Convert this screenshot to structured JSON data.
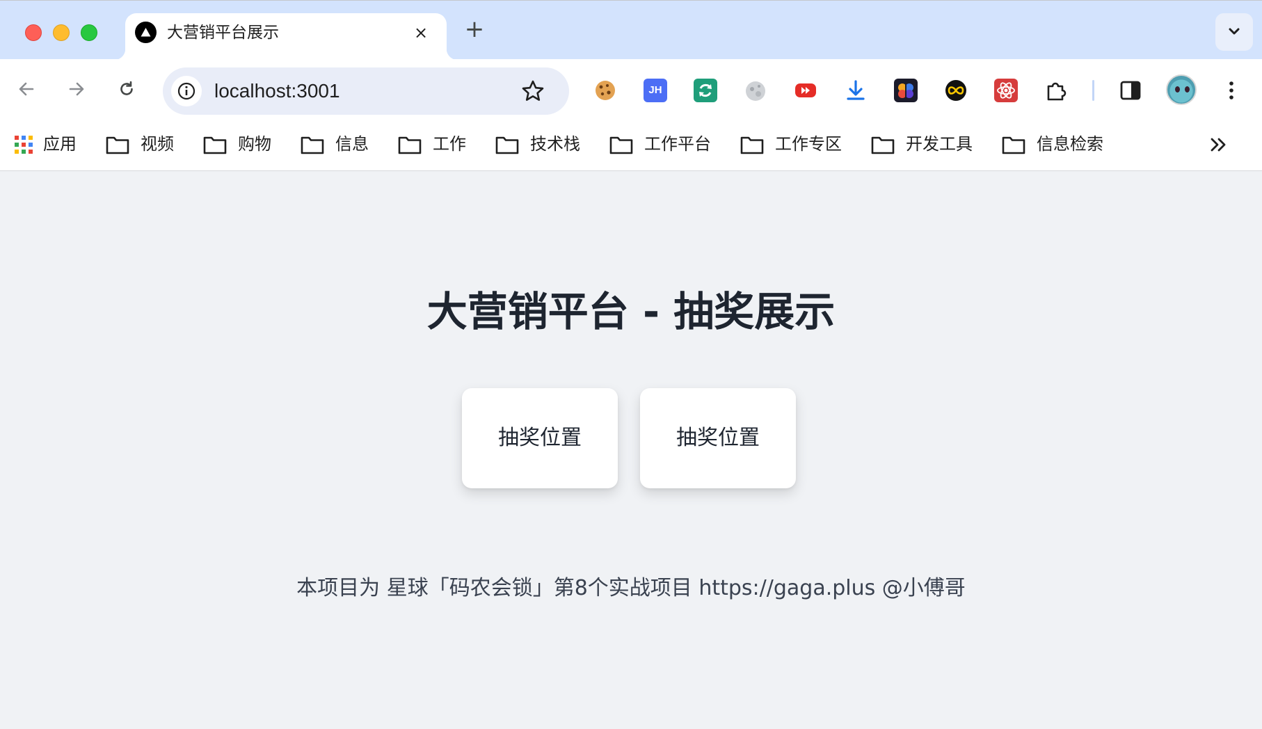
{
  "window": {
    "tab": {
      "title": "大营销平台展示",
      "favicon": "triangle-logo-icon",
      "close_icon": "×"
    },
    "new_tab_icon": "+"
  },
  "toolbar": {
    "url": "localhost:3001",
    "extensions": [
      "cookie-icon",
      "jh-icon",
      "refresh-ext-icon",
      "moon-ext-icon",
      "youtube-ext-icon",
      "download-icon",
      "brain-ext-icon",
      "infinity-ext-icon",
      "react-ext-icon",
      "puzzle-icon"
    ],
    "jh_label": "JH"
  },
  "bookmarks": {
    "items": [
      {
        "label": "应用",
        "icon": "apps-grid-icon"
      },
      {
        "label": "视频",
        "icon": "folder-icon"
      },
      {
        "label": "购物",
        "icon": "folder-icon"
      },
      {
        "label": "信息",
        "icon": "folder-icon"
      },
      {
        "label": "工作",
        "icon": "folder-icon"
      },
      {
        "label": "技术栈",
        "icon": "folder-icon"
      },
      {
        "label": "工作平台",
        "icon": "folder-icon"
      },
      {
        "label": "工作专区",
        "icon": "folder-icon"
      },
      {
        "label": "开发工具",
        "icon": "folder-icon"
      },
      {
        "label": "信息检索",
        "icon": "folder-icon"
      }
    ]
  },
  "page": {
    "title": "大营销平台 - 抽奖展示",
    "cards": [
      {
        "label": "抽奖位置"
      },
      {
        "label": "抽奖位置"
      }
    ],
    "footer": "本项目为 星球「码农会锁」第8个实战项目 https://gaga.plus @小傅哥"
  },
  "colors": {
    "tabstrip": "#d3e3fd",
    "page_bg": "#f0f2f5",
    "title_text": "#1e2530"
  }
}
